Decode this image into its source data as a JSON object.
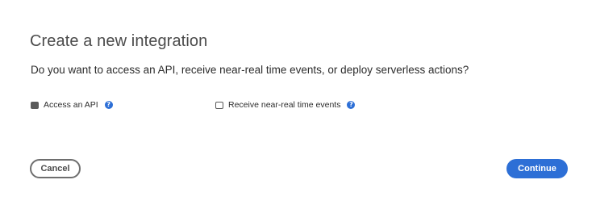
{
  "dialog": {
    "title": "Create a new integration",
    "question": "Do you want to access an API, receive near-real time events, or deploy serverless actions?",
    "options": [
      {
        "label": "Access an API",
        "selected": true,
        "help_icon": "question-circle-icon",
        "help_glyph": "?"
      },
      {
        "label": "Receive near-real time events",
        "selected": false,
        "help_icon": "question-circle-icon",
        "help_glyph": "?"
      }
    ],
    "buttons": {
      "cancel_label": "Cancel",
      "continue_label": "Continue"
    }
  },
  "colors": {
    "accent": "#2d6fd6",
    "text": "#2c2c2c",
    "radio": "#5a5a5a"
  }
}
